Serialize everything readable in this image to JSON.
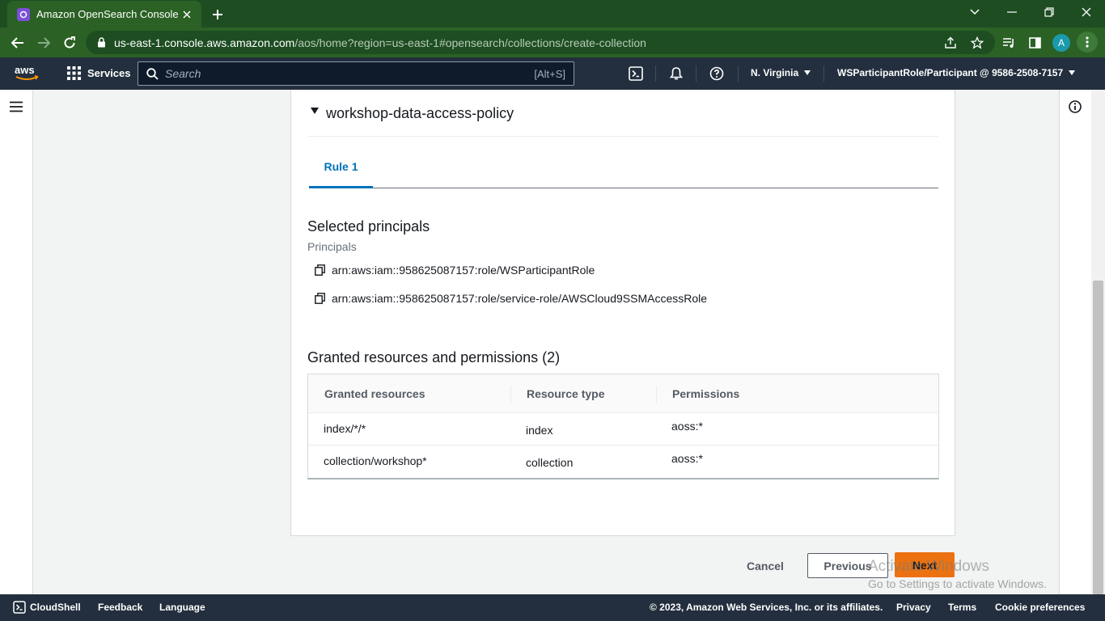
{
  "browser": {
    "tab_title": "Amazon OpenSearch Console",
    "url_host": "us-east-1.console.aws.amazon.com",
    "url_path": "/aos/home?region=us-east-1#opensearch/collections/create-collection",
    "profile_initial": "A"
  },
  "aws_nav": {
    "services_label": "Services",
    "search_placeholder": "Search",
    "search_shortcut": "[Alt+S]",
    "region": "N. Virginia",
    "account": "WSParticipantRole/Participant @ 9586-2508-7157"
  },
  "policy": {
    "name": "workshop-data-access-policy",
    "tabs": [
      {
        "label": "Rule 1"
      }
    ],
    "selected_principals_heading": "Selected principals",
    "principals_label": "Principals",
    "principals": [
      "arn:aws:iam::958625087157:role/WSParticipantRole",
      "arn:aws:iam::958625087157:role/service-role/AWSCloud9SSMAccessRole"
    ],
    "granted_heading": "Granted resources and permissions (2)",
    "table": {
      "headers": [
        "Granted resources",
        "Resource type",
        "Permissions"
      ],
      "rows": [
        [
          "index/*/*",
          "index",
          "aoss:*"
        ],
        [
          "collection/workshop*",
          "collection",
          "aoss:*"
        ]
      ]
    }
  },
  "actions": {
    "cancel": "Cancel",
    "previous": "Previous",
    "next": "Next"
  },
  "watermark": {
    "line1": "Activate Windows",
    "line2": "Go to Settings to activate Windows."
  },
  "footer": {
    "cloudshell": "CloudShell",
    "feedback": "Feedback",
    "language": "Language",
    "copyright": "© 2023, Amazon Web Services, Inc. or its affiliates.",
    "privacy": "Privacy",
    "terms": "Terms",
    "cookies": "Cookie preferences"
  },
  "colors": {
    "aws_nav": "#232f3e",
    "browser_frame": "#1d4d21",
    "link_blue": "#0073bb",
    "primary_orange": "#ec7211"
  }
}
